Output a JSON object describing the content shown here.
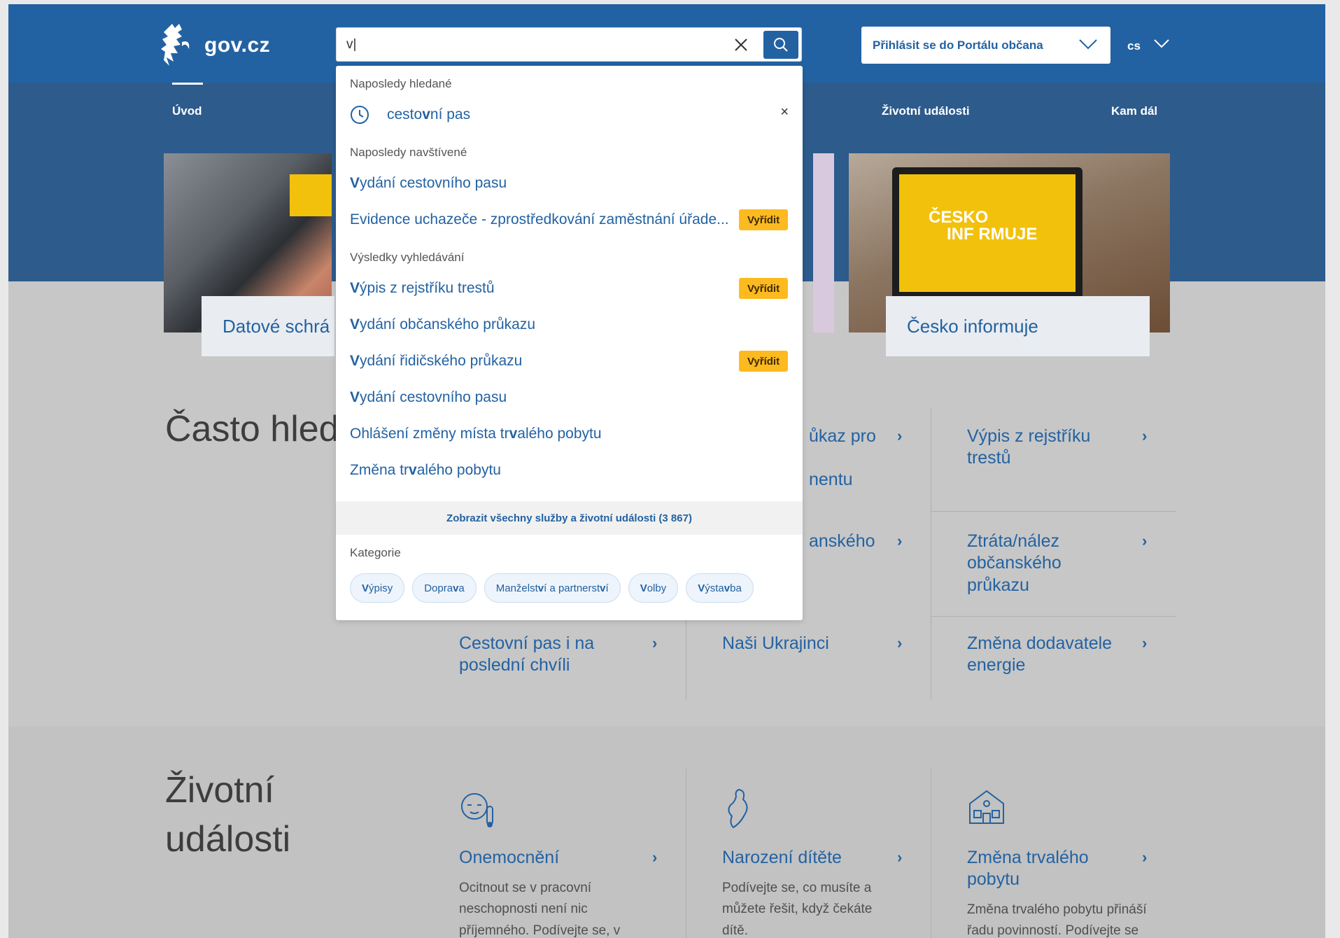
{
  "header": {
    "logo_text": "gov.cz",
    "search_value": "v|",
    "login_label": "Přihlásit se do Portálu občana",
    "lang": "cs"
  },
  "nav": {
    "items": [
      "Úvod",
      "Životní události",
      "Kam dál"
    ]
  },
  "hero": {
    "cards": [
      "Datové schrá",
      "Česko informuje"
    ],
    "screen_text_1": "ČESKO",
    "screen_text_2": "INF RMUJE"
  },
  "frequent": {
    "title": "Často hled",
    "links": [
      "ůkaz pro",
      "nentu",
      "Výpis z rejstříku trestů",
      "anského",
      "Ztráta/nález občanského průkazu",
      "Cestovní pas i na poslední chvíli",
      "Naši Ukrajinci",
      "Změna dodavatele energie"
    ]
  },
  "life_events": {
    "title": "Životní události",
    "items": [
      {
        "title": "Onemocnění",
        "desc": "Ocitnout se v pracovní neschopnosti není nic příjemného. Podívejte se, v"
      },
      {
        "title": "Narození dítěte",
        "desc": "Podívejte se, co musíte a můžete řešit, když čekáte dítě."
      },
      {
        "title": "Změna trvalého pobytu",
        "desc": "Změna trvalého pobytu přináší řadu povinností. Podívejte se"
      }
    ]
  },
  "dropdown": {
    "recent_searches_heading": "Naposledy hledané",
    "recent_search": {
      "pre": "cesto",
      "bold": "v",
      "post": "ní pas"
    },
    "recent_visited_heading": "Naposledy navštívené",
    "recent_visited": [
      {
        "pre": "",
        "bold": "V",
        "post": "ydání cestovního pasu",
        "badge": ""
      },
      {
        "pre": "Evidence uchazeče - zprostředkování zaměstnání úřade...",
        "bold": "",
        "post": "",
        "badge": "Vyřídit"
      }
    ],
    "results_heading": "Výsledky vyhledávání",
    "results": [
      {
        "pre": "",
        "bold": "V",
        "post": "ýpis z rejstříku trestů",
        "badge": "Vyřídit"
      },
      {
        "pre": "",
        "bold": "V",
        "post": "ydání občanského průkazu",
        "badge": ""
      },
      {
        "pre": "",
        "bold": "V",
        "post": "ydání řidičského průkazu",
        "badge": "Vyřídit"
      },
      {
        "pre": "",
        "bold": "V",
        "post": "ydání cestovního pasu",
        "badge": ""
      },
      {
        "pre": "Ohlášení změny místa tr",
        "bold": "v",
        "post": "alého pobytu",
        "badge": ""
      },
      {
        "pre": "Změna tr",
        "bold": "v",
        "post": "alého pobytu",
        "badge": ""
      }
    ],
    "show_all": "Zobrazit všechny služby a životní události (3 867)",
    "categories_heading": "Kategorie",
    "categories": [
      {
        "pre": "",
        "bold": "V",
        "post": "ýpisy"
      },
      {
        "pre": "Dopra",
        "bold": "v",
        "post": "a"
      },
      {
        "pre": "Manželst",
        "bold": "v",
        "post": "í a partnerst",
        "bold2": "v",
        "post2": "í"
      },
      {
        "pre": "",
        "bold": "V",
        "post": "olby"
      },
      {
        "pre": "",
        "bold": "V",
        "post": "ýsta",
        "bold2": "v",
        "post2": "ba"
      }
    ]
  },
  "colors": {
    "brand_blue": "#2362a2",
    "badge_yellow": "#fdba20"
  }
}
